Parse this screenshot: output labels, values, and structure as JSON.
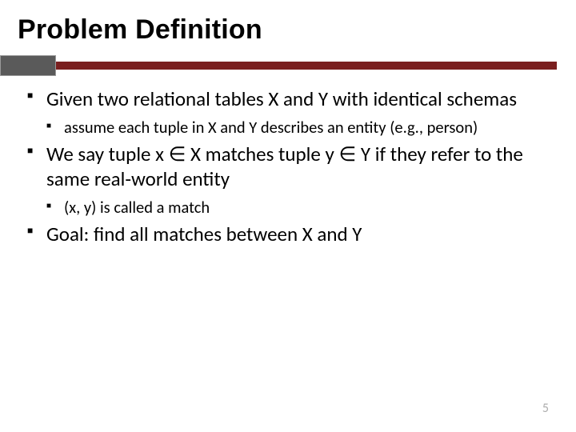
{
  "title": "Problem Definition",
  "bullets": {
    "b1": "Given two relational tables X and Y with identical schemas",
    "b1s1": "assume each tuple in X and Y describes an entity (e.g., person)",
    "b2a": "We say tuple x ",
    "b2b": " X matches tuple y ",
    "b2c": " Y if they refer to the same real-world entity",
    "in": "∈",
    "b2s1": "(x, y) is called a match",
    "b3": "Goal: find all matches between X and Y"
  },
  "page_number": "5"
}
